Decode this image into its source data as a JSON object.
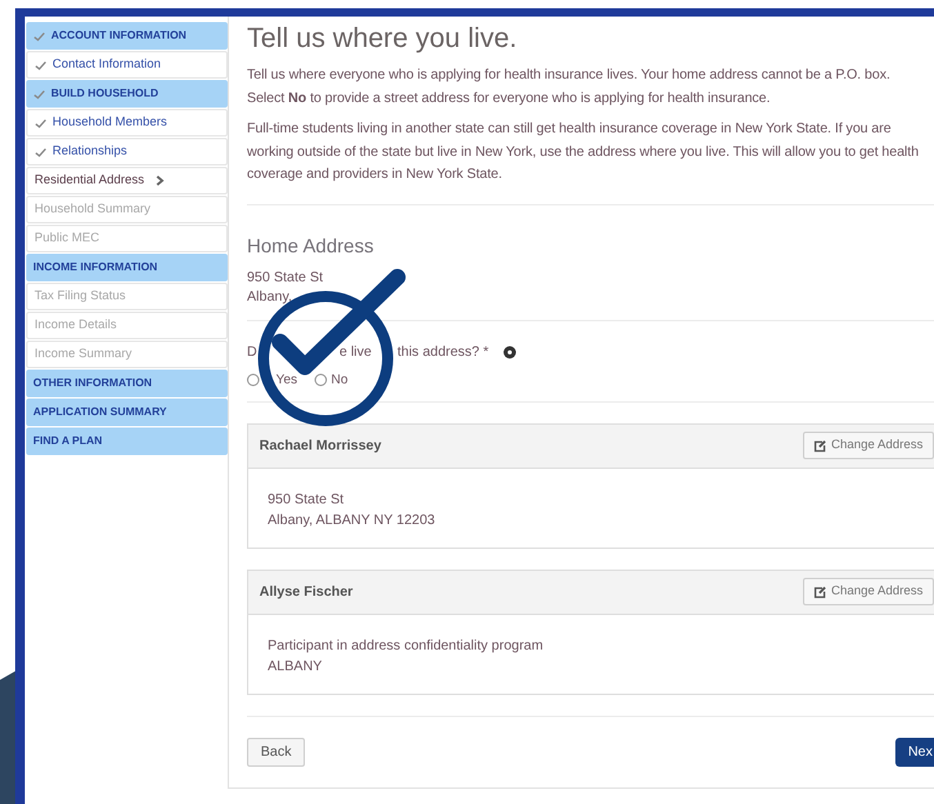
{
  "sidebar": {
    "items": [
      {
        "kind": "section",
        "label": "ACCOUNT INFORMATION",
        "completed": true
      },
      {
        "kind": "page",
        "label": "Contact Information",
        "completed": true,
        "current": false,
        "disabled": false
      },
      {
        "kind": "section",
        "label": "BUILD HOUSEHOLD",
        "completed": true
      },
      {
        "kind": "page",
        "label": "Household Members",
        "completed": true,
        "current": false,
        "disabled": false
      },
      {
        "kind": "page",
        "label": "Relationships",
        "completed": true,
        "current": false,
        "disabled": false
      },
      {
        "kind": "page",
        "label": "Residential Address",
        "completed": false,
        "current": true,
        "disabled": false
      },
      {
        "kind": "page",
        "label": "Household Summary",
        "completed": false,
        "current": false,
        "disabled": true
      },
      {
        "kind": "page",
        "label": "Public MEC",
        "completed": false,
        "current": false,
        "disabled": true
      },
      {
        "kind": "section",
        "label": "INCOME INFORMATION",
        "completed": false
      },
      {
        "kind": "page",
        "label": "Tax Filing Status",
        "completed": false,
        "current": false,
        "disabled": true
      },
      {
        "kind": "page",
        "label": "Income Details",
        "completed": false,
        "current": false,
        "disabled": true
      },
      {
        "kind": "page",
        "label": "Income Summary",
        "completed": false,
        "current": false,
        "disabled": true
      },
      {
        "kind": "section",
        "label": "OTHER INFORMATION",
        "completed": false
      },
      {
        "kind": "section",
        "label": "APPLICATION SUMMARY",
        "completed": false
      },
      {
        "kind": "section",
        "label": "FIND A PLAN",
        "completed": false
      }
    ]
  },
  "main": {
    "title": "Tell us where you live.",
    "paragraphs": [
      "Tell us where everyone who is applying for health insurance lives. Your home address cannot be a P.O. box. Select **No** to provide a street address for everyone who is applying for health insurance.",
      "Full-time students living in another state can still get health insurance coverage in New York State. If you are working outside of the state but live in New York, use the address where you live. This will allow you to get health coverage and providers in New York State."
    ],
    "home_address": {
      "heading": "Home Address",
      "lines": [
        "950 State St",
        "Albany,"
      ]
    },
    "question": {
      "fragments": [
        "D",
        "e live",
        "this address? *"
      ],
      "options": [
        {
          "label": "Yes",
          "selected": false
        },
        {
          "label": "No",
          "selected": false
        }
      ]
    },
    "members": [
      {
        "name": "Rachael Morrissey",
        "button": "Change Address",
        "lines": [
          "950 State St",
          "Albany, ALBANY NY 12203"
        ]
      },
      {
        "name": "Allyse Fischer",
        "button": "Change Address",
        "lines": [
          "Participant in address confidentiality program",
          "ALBANY"
        ]
      }
    ],
    "back_button": "Back",
    "next_button": "Nex"
  }
}
